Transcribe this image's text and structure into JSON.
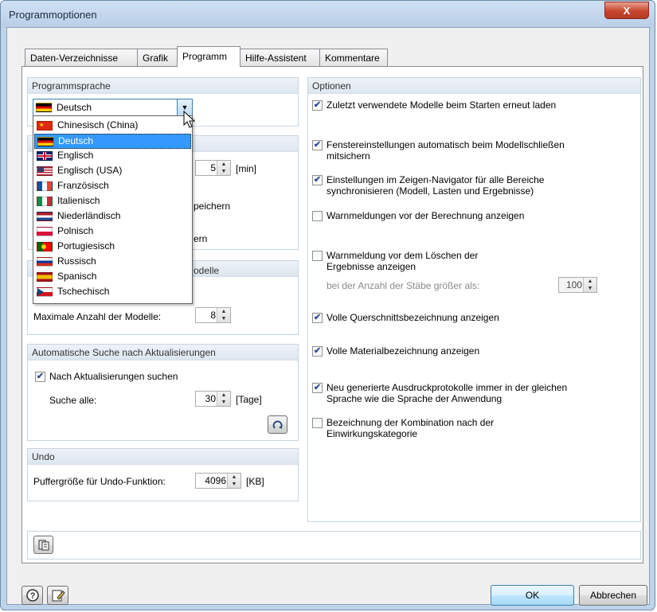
{
  "window": {
    "title": "Programmoptionen",
    "close_glyph": "X"
  },
  "tabs": [
    {
      "label": "Daten-Verzeichnisse"
    },
    {
      "label": "Grafik"
    },
    {
      "label": "Programm"
    },
    {
      "label": "Hilfe-Assistent"
    },
    {
      "label": "Kommentare"
    }
  ],
  "left": {
    "programmsprache": {
      "header": "Programmsprache",
      "selected": "Deutsch",
      "options": [
        {
          "label": "Chinesisch  (China)",
          "icon": "flag-china-icon"
        },
        {
          "label": "Deutsch",
          "icon": "flag-germany-icon",
          "selected": true
        },
        {
          "label": "Englisch",
          "icon": "flag-uk-icon"
        },
        {
          "label": "Englisch (USA)",
          "icon": "flag-usa-icon"
        },
        {
          "label": "Französisch",
          "icon": "flag-france-icon"
        },
        {
          "label": "Italienisch",
          "icon": "flag-italy-icon"
        },
        {
          "label": "Niederländisch",
          "icon": "flag-netherlands-icon"
        },
        {
          "label": "Polnisch",
          "icon": "flag-poland-icon"
        },
        {
          "label": "Portugiesisch",
          "icon": "flag-portugal-icon"
        },
        {
          "label": "Russisch",
          "icon": "flag-russia-icon"
        },
        {
          "label": "Spanisch",
          "icon": "flag-spain-icon"
        },
        {
          "label": "Tschechisch",
          "icon": "flag-czech-icon"
        }
      ]
    },
    "autosave": {
      "value": "5",
      "unit": "[min]",
      "partial_1": "peichern",
      "partial_2": "ern"
    },
    "modelle": {
      "header_partial": "odelle",
      "max_label": "Maximale Anzahl der Modelle:",
      "max_value": "8"
    },
    "updates": {
      "header": "Automatische Suche nach Aktualisierungen",
      "check_label": "Nach Aktualisierungen suchen",
      "checked": true,
      "interval_label": "Suche alle:",
      "interval_value": "30",
      "interval_unit": "[Tage]"
    },
    "undo": {
      "header": "Undo",
      "buffer_label": "Puffergröße für Undo-Funktion:",
      "buffer_value": "4096",
      "buffer_unit": "[KB]"
    }
  },
  "optionen": {
    "header": "Optionen",
    "items": [
      {
        "line1": "Zuletzt verwendete Modelle beim Starten erneut laden",
        "line2": "",
        "checked": true
      },
      {
        "line1": "Fenstereinstellungen automatisch beim Modellschließen",
        "line2": "mitsichern",
        "checked": true
      },
      {
        "line1": "Einstellungen im Zeigen-Navigator für alle Bereiche",
        "line2": "synchronisieren (Modell, Lasten und Ergebnisse)",
        "checked": true
      },
      {
        "line1": "Warnmeldungen vor der Berechnung anzeigen",
        "line2": "",
        "checked": false
      },
      {
        "line1": "Warnmeldung vor dem Löschen der",
        "line2": "Ergebnisse anzeigen",
        "checked": false
      },
      {
        "line1": "Volle Querschnittsbezeichnung anzeigen",
        "line2": "",
        "checked": true
      },
      {
        "line1": "Volle Materialbezeichnung anzeigen",
        "line2": "",
        "checked": true
      },
      {
        "line1": "Neu generierte Ausdruckprotokolle immer in der gleichen",
        "line2": "Sprache wie die Sprache der Anwendung",
        "checked": true
      },
      {
        "line1": "Bezeichnung der Kombination nach der",
        "line2": "Einwirkungskategorie",
        "checked": false
      }
    ],
    "stab_label": "bei der Anzahl der Stäbe größer als:",
    "stab_value": "100"
  },
  "footer": {
    "ok": "OK",
    "cancel": "Abbrechen"
  },
  "colors": {
    "accent": "#3399ff",
    "title_bar": "#bdd3ea",
    "group_header": "#dde6ef"
  }
}
